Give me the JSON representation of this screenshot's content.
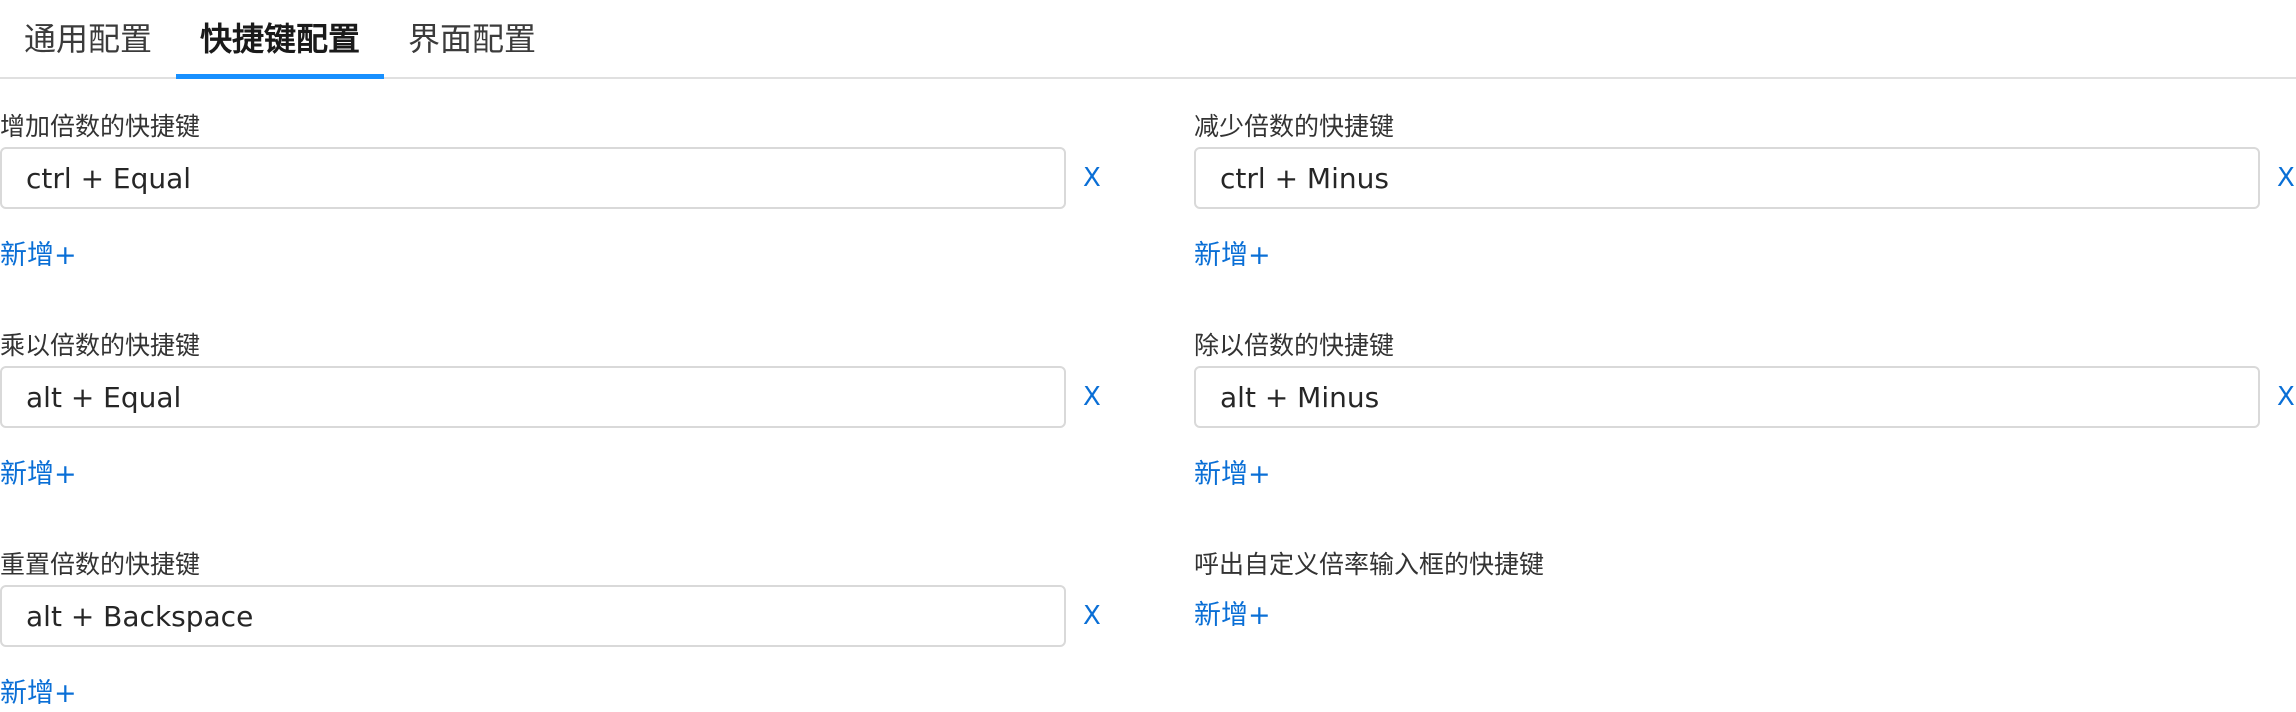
{
  "tabs": [
    {
      "label": "通用配置",
      "active": false
    },
    {
      "label": "快捷键配置",
      "active": true
    },
    {
      "label": "界面配置",
      "active": false
    }
  ],
  "shortcuts": {
    "increase": {
      "label": "增加倍数的快捷键",
      "values": [
        "ctrl + Equal"
      ],
      "add_label": "新增+",
      "delete_label": "X"
    },
    "decrease": {
      "label": "减少倍数的快捷键",
      "values": [
        "ctrl + Minus"
      ],
      "add_label": "新增+",
      "delete_label": "X"
    },
    "multiply": {
      "label": "乘以倍数的快捷键",
      "values": [
        "alt + Equal"
      ],
      "add_label": "新增+",
      "delete_label": "X"
    },
    "divide": {
      "label": "除以倍数的快捷键",
      "values": [
        "alt + Minus"
      ],
      "add_label": "新增+",
      "delete_label": "X"
    },
    "reset": {
      "label": "重置倍数的快捷键",
      "values": [
        "alt + Backspace"
      ],
      "add_label": "新增+",
      "delete_label": "X"
    },
    "custom_rate": {
      "label": "呼出自定义倍率输入框的快捷键",
      "values": [],
      "add_label": "新增+"
    }
  },
  "colors": {
    "accent": "#1890ff",
    "link": "#0a6fd6",
    "border": "#d9d9d9"
  }
}
